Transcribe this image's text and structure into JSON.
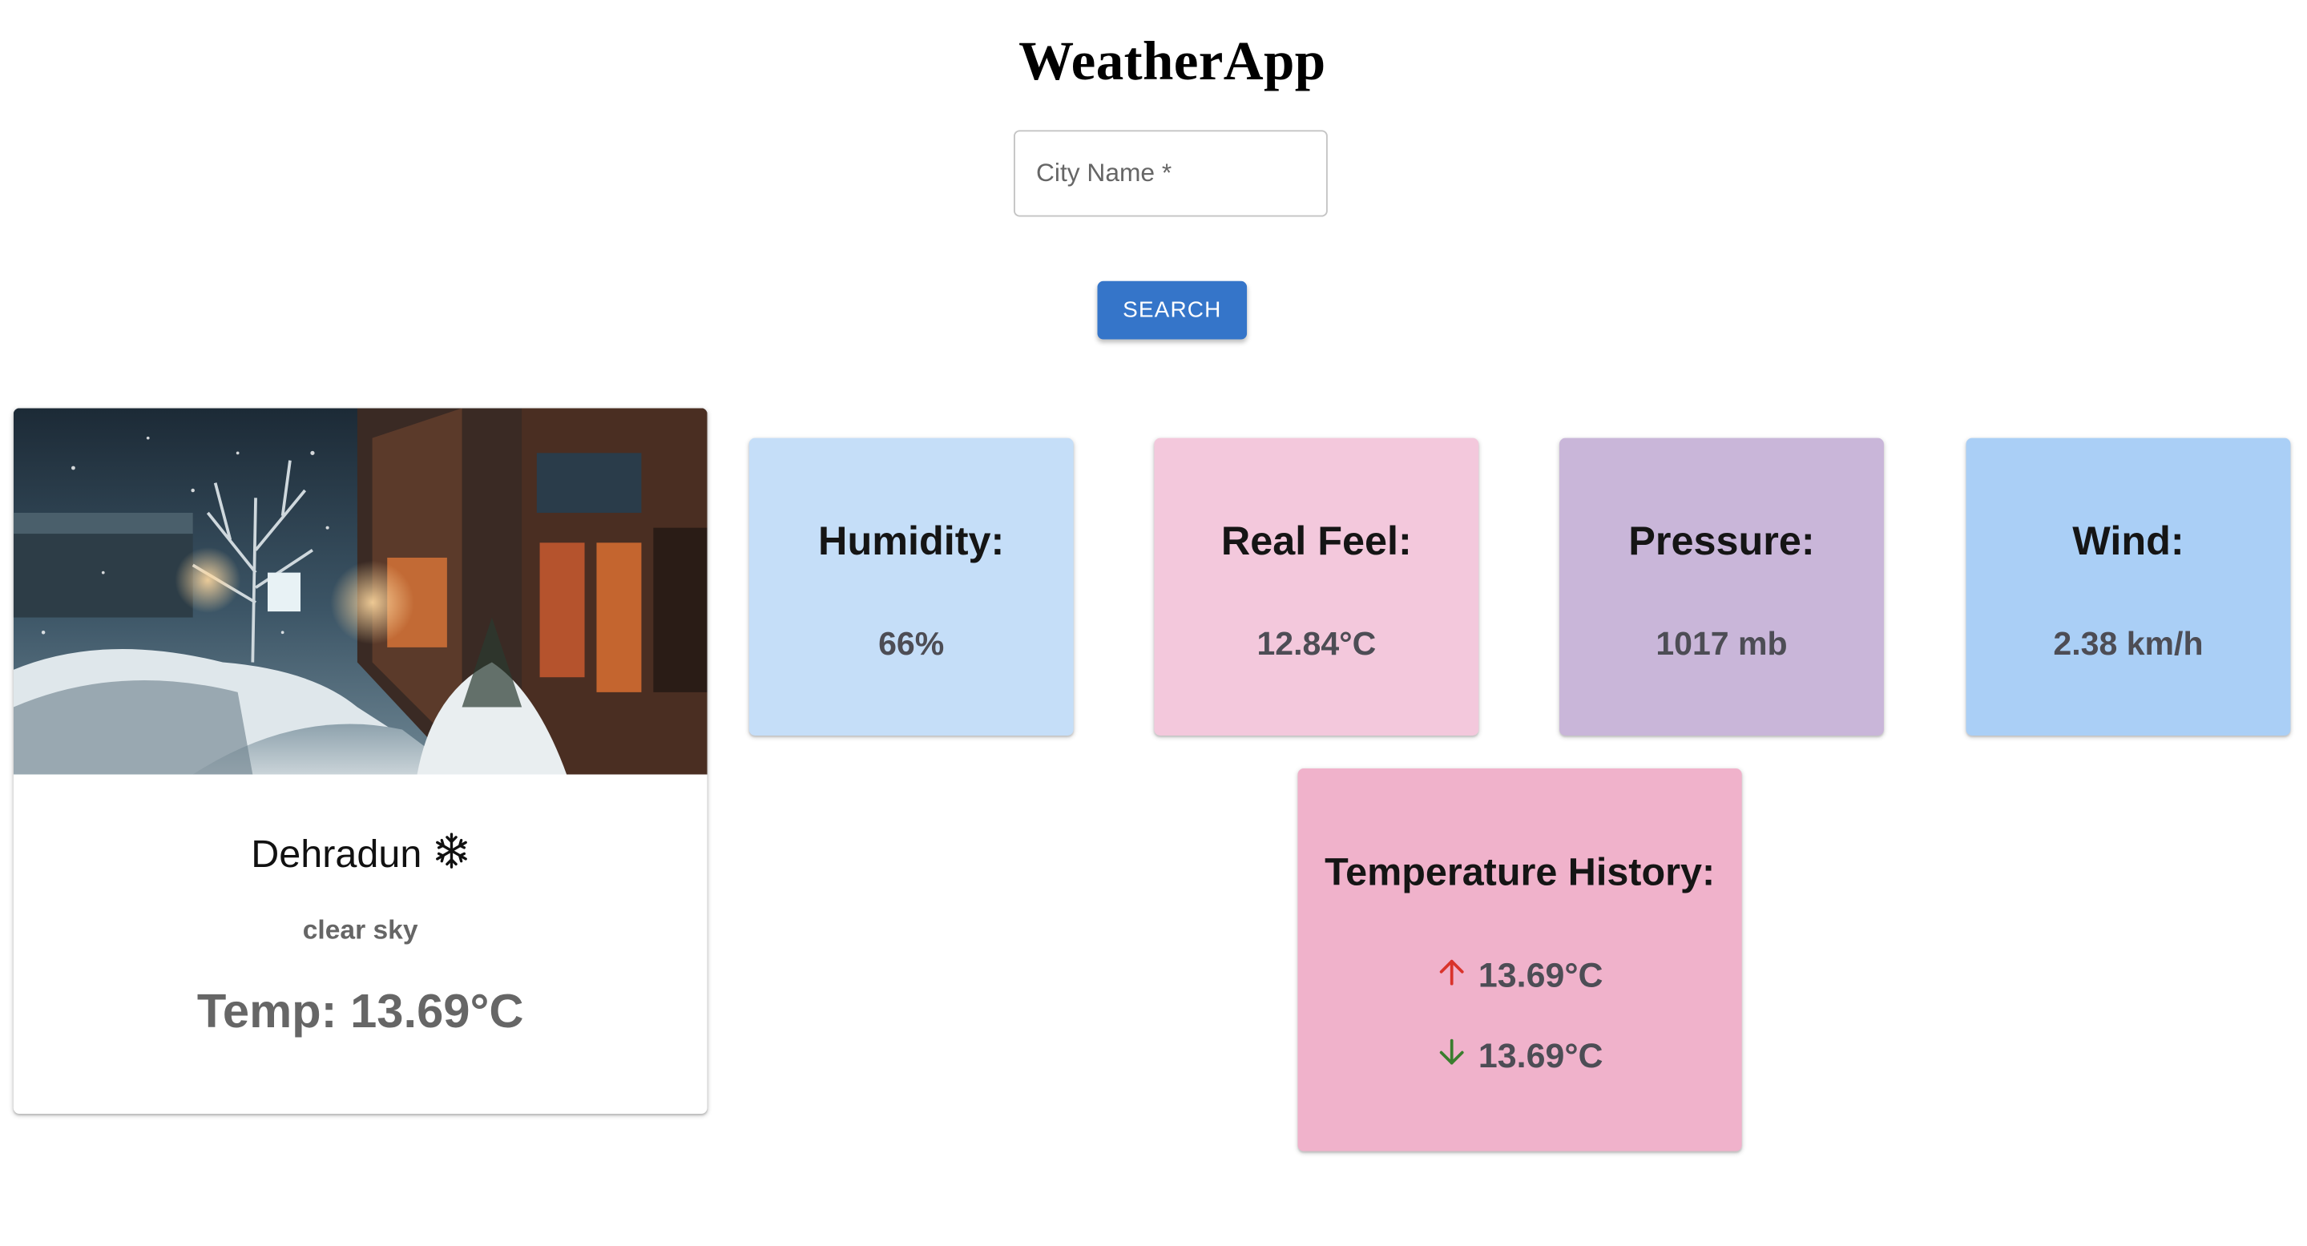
{
  "header": {
    "title": "WeatherApp"
  },
  "search": {
    "placeholder": "City Name *",
    "value": "",
    "button_label": "SEARCH"
  },
  "main_card": {
    "city": "Dehradun",
    "weather_icon": "snowflake-icon",
    "description": "clear sky",
    "temperature": "Temp: 13.69°C"
  },
  "stats": {
    "humidity": {
      "label": "Humidity:",
      "value": "66%",
      "color": "#c5def8"
    },
    "real_feel": {
      "label": "Real Feel:",
      "value": "12.84°C",
      "color": "#f3c8dc"
    },
    "pressure": {
      "label": "Pressure:",
      "value": "1017 mb",
      "color": "#c9b6d9"
    },
    "wind": {
      "label": "Wind:",
      "value": "2.38 km/h",
      "color": "#aacff6"
    }
  },
  "history": {
    "title": "Temperature History:",
    "color": "#f0b2cb",
    "max": {
      "icon": "arrow-up-icon",
      "value": "13.69°C",
      "color": "#d9332b"
    },
    "min": {
      "icon": "arrow-down-icon",
      "value": "13.69°C",
      "color": "#3a7d2e"
    }
  },
  "colors": {
    "accent": "#3575c9"
  }
}
